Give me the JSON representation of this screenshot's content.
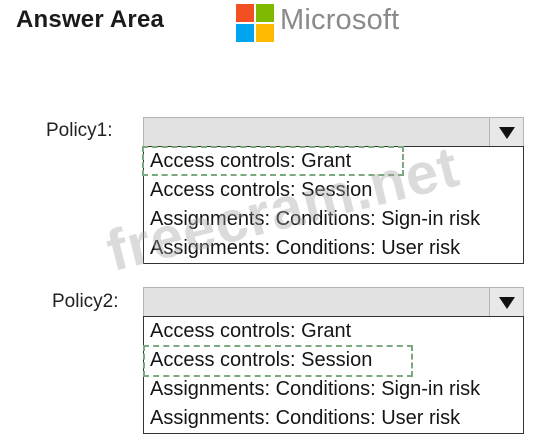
{
  "header": {
    "title": "Answer Area",
    "brand": {
      "name": "Microsoft",
      "colors": [
        "#f25022",
        "#7fba00",
        "#00a4ef",
        "#ffb900"
      ]
    }
  },
  "policies": [
    {
      "label": "Policy1:",
      "selected_index": 0,
      "options": [
        "Access controls: Grant",
        "Access controls: Session",
        "Assignments: Conditions: Sign-in risk",
        "Assignments: Conditions: User risk"
      ]
    },
    {
      "label": "Policy2:",
      "selected_index": 1,
      "options": [
        "Access controls: Grant",
        "Access controls: Session",
        "Assignments: Conditions: Sign-in risk",
        "Assignments: Conditions: User risk"
      ]
    }
  ],
  "watermark": "freecram.net",
  "icons": {
    "dropdown_arrow": "triangle-down-icon",
    "logo": "microsoft-logo-icon"
  }
}
